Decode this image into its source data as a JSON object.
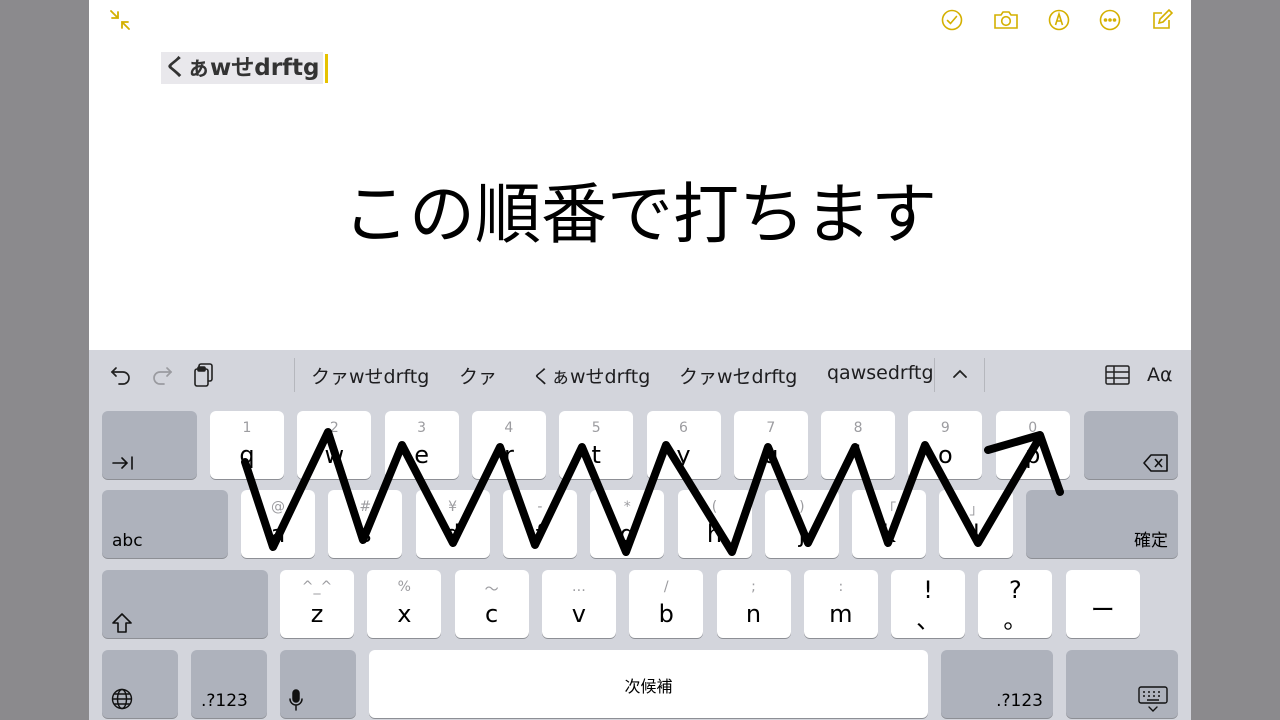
{
  "note": {
    "draft_text": "くぁwせdrftg",
    "caption": "この順番で打ちます"
  },
  "toolbar": {
    "icons": [
      "collapse-icon",
      "checklist-icon",
      "camera-icon",
      "markup-pen-icon",
      "more-icon",
      "compose-icon"
    ],
    "accent": "#e6c200"
  },
  "keyboard": {
    "candidates": [
      "クァwせdrftg",
      "クァ",
      "くぁwせdrftg",
      "クァwセdrftg",
      "qawsedrftg"
    ],
    "format_label": "Aα",
    "row1": [
      {
        "sub": "1",
        "main": "q"
      },
      {
        "sub": "2",
        "main": "w"
      },
      {
        "sub": "3",
        "main": "e"
      },
      {
        "sub": "4",
        "main": "r"
      },
      {
        "sub": "5",
        "main": "t"
      },
      {
        "sub": "6",
        "main": "y"
      },
      {
        "sub": "7",
        "main": "u"
      },
      {
        "sub": "8",
        "main": "i"
      },
      {
        "sub": "9",
        "main": "o"
      },
      {
        "sub": "0",
        "main": "p"
      }
    ],
    "row2": [
      {
        "sub": "@",
        "main": "a"
      },
      {
        "sub": "#",
        "main": "s"
      },
      {
        "sub": "¥",
        "main": "d"
      },
      {
        "sub": "-",
        "main": "f"
      },
      {
        "sub": "*",
        "main": "g"
      },
      {
        "sub": "(",
        "main": "h"
      },
      {
        "sub": ")",
        "main": "j"
      },
      {
        "sub": "「",
        "main": "k"
      },
      {
        "sub": "」",
        "main": "l"
      }
    ],
    "row3": [
      {
        "sub": "^_^",
        "main": "z"
      },
      {
        "sub": "%",
        "main": "x"
      },
      {
        "sub": "〜",
        "main": "c"
      },
      {
        "sub": "…",
        "main": "v"
      },
      {
        "sub": "/",
        "main": "b"
      },
      {
        "sub": ";",
        "main": "n"
      },
      {
        "sub": ":",
        "main": "m"
      },
      {
        "sub": "!",
        "main": "、"
      },
      {
        "sub": "?",
        "main": "。"
      },
      {
        "sub": "",
        "main": "ー"
      }
    ],
    "abc_label": "abc",
    "confirm_label": "確定",
    "numbers_label": ".?123",
    "space_label": "次候補"
  }
}
